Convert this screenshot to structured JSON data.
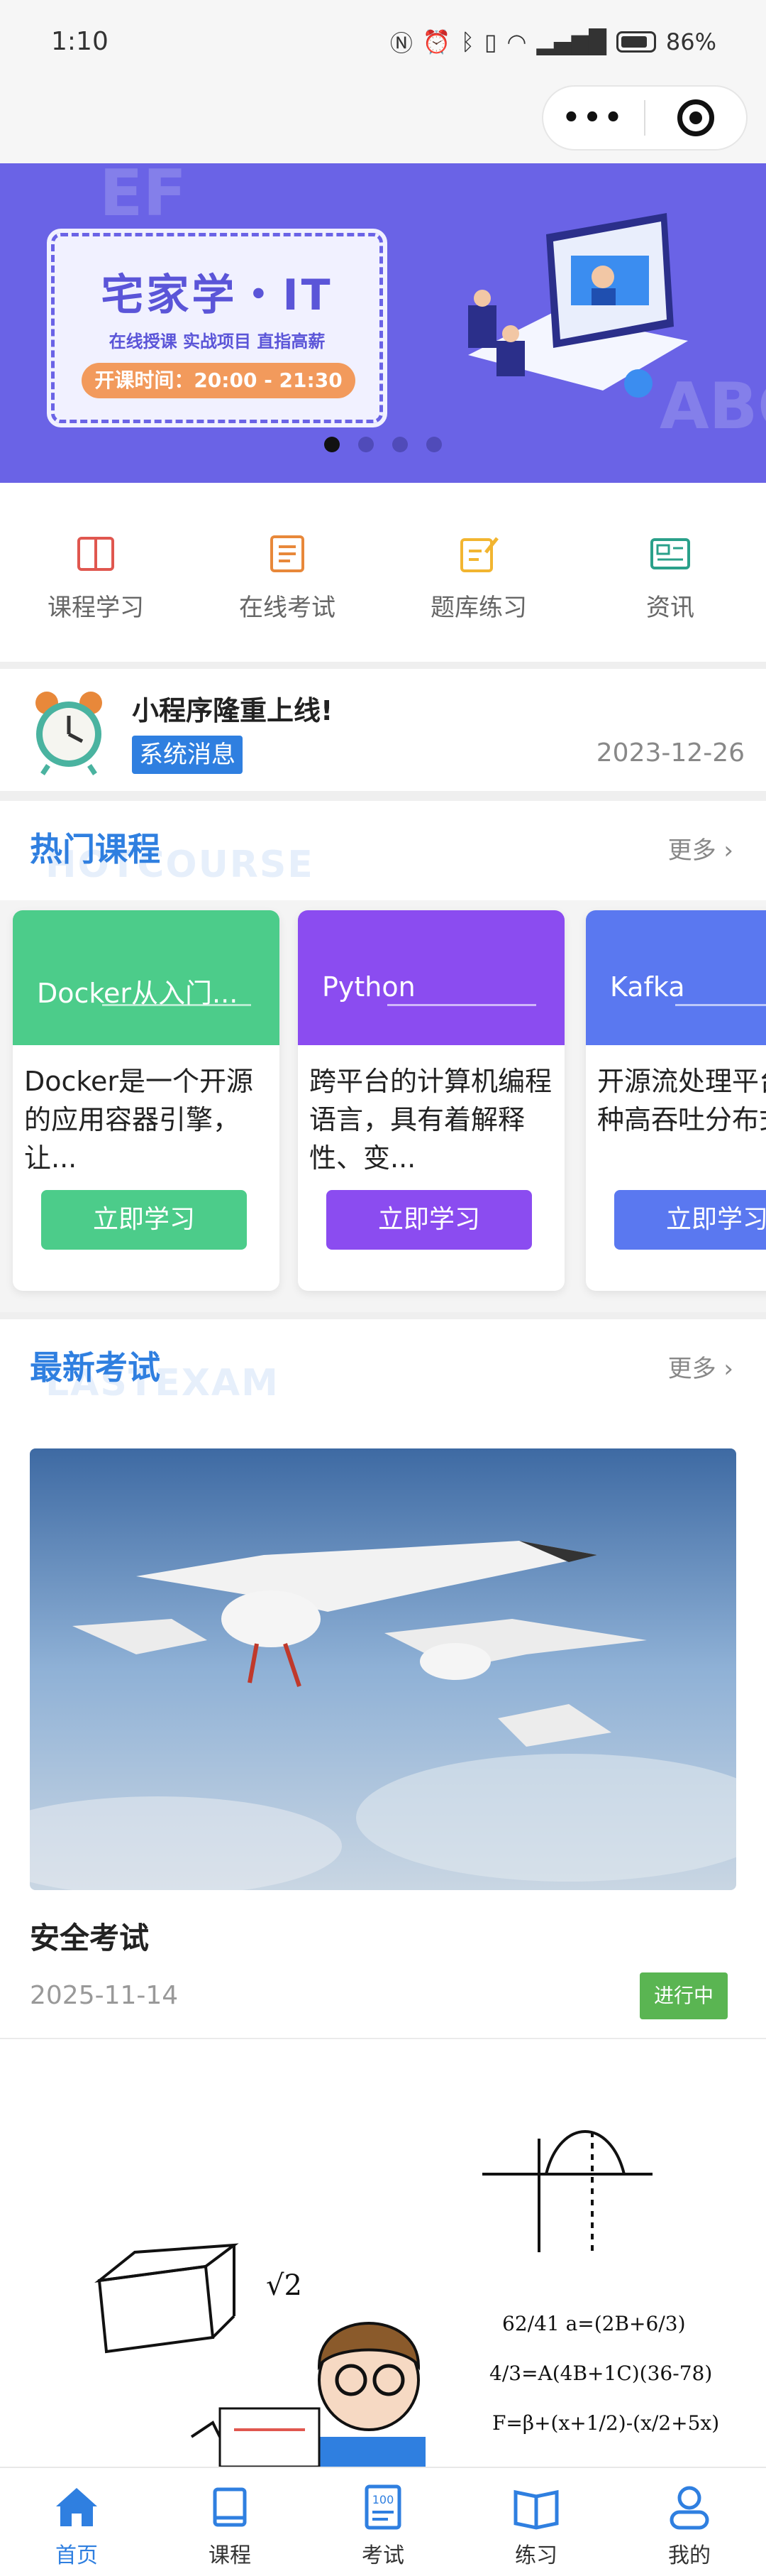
{
  "status_bar": {
    "time": "1:10",
    "icons": [
      "nfc-icon",
      "alarm-icon",
      "bluetooth-icon",
      "vibrate-icon",
      "wifi-icon",
      "signal-icon",
      "battery-icon"
    ],
    "battery": "86%"
  },
  "navbar": {
    "more_label": "•••"
  },
  "banner": {
    "title": "宅家学・IT",
    "subtitle": "在线授课  实战项目  直指高薪",
    "time_label": "开课时间：20:00 - 21:30",
    "slide_count": 4,
    "active_index": 0,
    "bg_color": "#6a63e6"
  },
  "quick_entries": [
    {
      "label": "课程学习",
      "icon": "book-icon",
      "color": "#e0574f"
    },
    {
      "label": "在线考试",
      "icon": "exam-icon",
      "color": "#e8883a"
    },
    {
      "label": "题库练习",
      "icon": "edit-icon",
      "color": "#f2b530"
    },
    {
      "label": "资讯",
      "icon": "news-icon",
      "color": "#2aa08a"
    }
  ],
  "notice": {
    "title": "小程序隆重上线!",
    "badge": "系统消息",
    "date": "2023-12-26"
  },
  "hot_courses": {
    "title": "热门课程",
    "title_en": "HOTCOURSE",
    "more": "更多",
    "items": [
      {
        "name": "Docker从入门...",
        "desc": "Docker是一个开源的应用容器引擎，让...",
        "button": "立即学习",
        "color": "#4ccc8a"
      },
      {
        "name": "Python",
        "desc": "跨平台的计算机编程语言，具有着解释性、变...",
        "button": "立即学习",
        "color": "#8b4cf0"
      },
      {
        "name": "Kafka",
        "desc": "开源流处理平台是一种高吞吐分布式发...",
        "button": "立即学习",
        "color": "#5a78f0"
      }
    ]
  },
  "latest_exam": {
    "title": "最新考试",
    "title_en": "LASTEXAM",
    "more": "更多",
    "item": {
      "title": "安全考试",
      "date": "2025-11-14",
      "status": "进行中"
    }
  },
  "tabbar": [
    {
      "label": "首页",
      "icon": "home-icon",
      "active": true
    },
    {
      "label": "课程",
      "icon": "course-icon",
      "active": false
    },
    {
      "label": "考试",
      "icon": "exam-100-icon",
      "active": false
    },
    {
      "label": "练习",
      "icon": "practice-book-icon",
      "active": false
    },
    {
      "label": "我的",
      "icon": "user-icon",
      "active": false
    }
  ]
}
